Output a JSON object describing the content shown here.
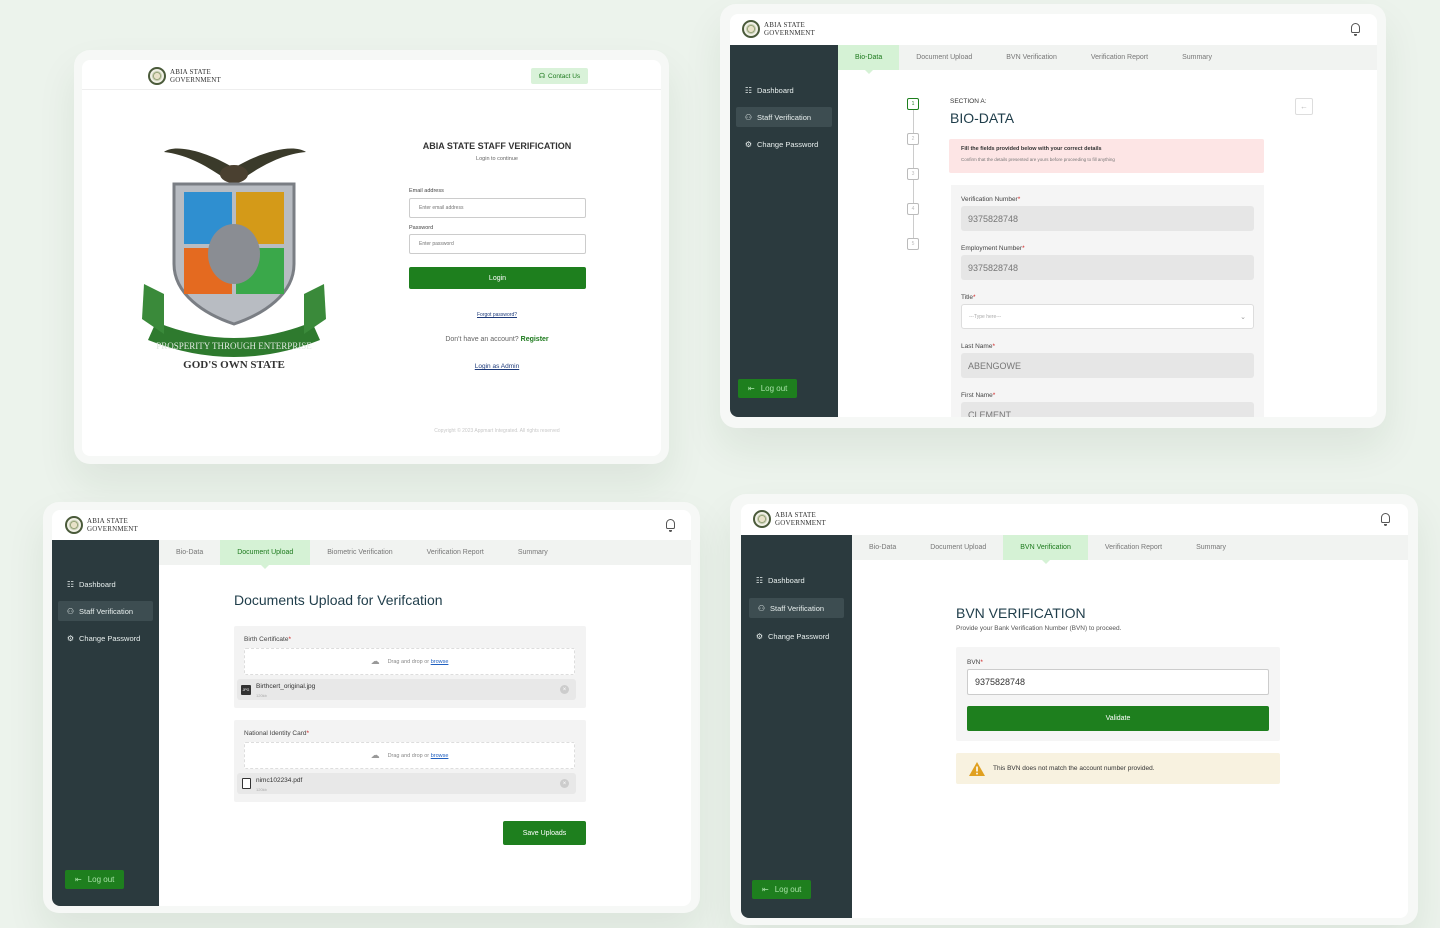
{
  "logo": {
    "line1": "ABIA STATE",
    "line2": "GOVERNMENT"
  },
  "login": {
    "contact": "Contact Us",
    "title": "ABIA STATE STAFF VERIFICATION",
    "subtitle": "Login to continue",
    "email_label": "Email address",
    "email_placeholder": "Enter email address",
    "password_label": "Password",
    "password_placeholder": "Enter password",
    "login_button": "Login",
    "forgot": "Forgot password?",
    "no_account": "Don't have an account?",
    "register": "Register",
    "admin": "Login as Admin",
    "copyright": "Copyright © 2023 Appmart Integrated. All rights reserved",
    "crest_motto": "PROSPERITY THROUGH ENTERPRISE",
    "crest_state": "GOD'S OWN STATE"
  },
  "sidebar": {
    "dashboard": "Dashboard",
    "staff_verification": "Staff Verification",
    "change_password": "Change Password",
    "logout": "Log out"
  },
  "biodata": {
    "tabs": [
      "Bio-Data",
      "Document Upload",
      "BVN Verification",
      "Verification Report",
      "Summary"
    ],
    "steps": [
      "1",
      "2",
      "3",
      "4",
      "5"
    ],
    "section": "SECTION A:",
    "title": "BIO-DATA",
    "alert_title": "Fill the fields provided below with your correct details",
    "alert_text": "Confirm that the details presented are yours before proceeding to fill anything",
    "verification_label": "Verification Number",
    "verification_value": "9375828748",
    "employment_label": "Employment Number",
    "employment_value": "9375828748",
    "title_label": "Title",
    "title_placeholder": "---Type here---",
    "lastname_label": "Last Name",
    "lastname_value": "ABENGOWE",
    "firstname_label": "First Name",
    "firstname_value": "CLEMENT"
  },
  "docs": {
    "tabs": [
      "Bio-Data",
      "Document Upload",
      "Biometric Verification",
      "Verification Report",
      "Summary"
    ],
    "title": "Documents Upload for Verifcation",
    "birth_label": "Birth Certificate",
    "nin_label": "National Identity Card",
    "drag_text": "Drag and drop or",
    "browse": "browse",
    "file1_name": "Birthcert_original.jpg",
    "file1_size": "120kb",
    "file1_type": "JPG",
    "file2_name": "nimc102234.pdf",
    "file2_size": "120kb",
    "save": "Save Uploads"
  },
  "bvn": {
    "tabs": [
      "Bio-Data",
      "Document Upload",
      "BVN Verification",
      "Verification Report",
      "Summary"
    ],
    "title": "BVN VERIFICATION",
    "subtitle": "Provide your Bank Verification Number (BVN) to proceed.",
    "label": "BVN",
    "value": "9375828748",
    "validate": "Validate",
    "warning": "This BVN does not match the account number provided."
  }
}
